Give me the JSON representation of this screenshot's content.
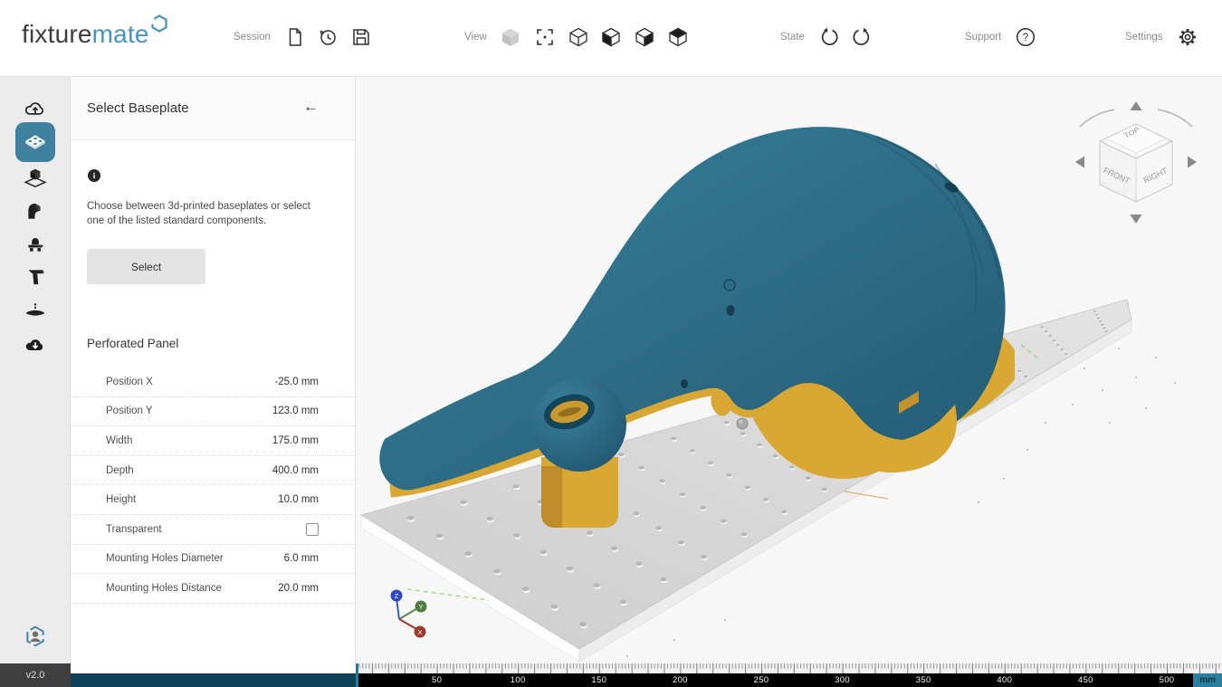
{
  "brand": {
    "name_primary": "fixture",
    "name_secondary": "mate",
    "version": "v2.0"
  },
  "topbar": {
    "session": {
      "label": "Session",
      "icons": [
        "new-file",
        "history",
        "save"
      ]
    },
    "view": {
      "label": "View",
      "icons": [
        "shaded-cube",
        "zoom-fit",
        "cube-wireframe",
        "cube-left-face",
        "cube-right-face",
        "cube-top-face"
      ]
    },
    "state": {
      "label": "State",
      "icons": [
        "undo",
        "redo"
      ]
    },
    "support": {
      "label": "Support",
      "icon": "help-circle"
    },
    "settings": {
      "label": "Settings",
      "icon": "gear"
    }
  },
  "sidebar": {
    "items": [
      {
        "name": "import-part",
        "icon": "cloud-upload-icon",
        "active": false
      },
      {
        "name": "select-baseplate",
        "icon": "baseplate-icon",
        "active": true
      },
      {
        "name": "orient-part",
        "icon": "part-on-plate-icon",
        "active": false
      },
      {
        "name": "fixture-body",
        "icon": "fixture-block-icon",
        "active": false
      },
      {
        "name": "supports",
        "icon": "part-supports-icon",
        "active": false
      },
      {
        "name": "clamps",
        "icon": "clamp-icon",
        "active": false
      },
      {
        "name": "spacers",
        "icon": "disc-icon",
        "active": false
      },
      {
        "name": "export",
        "icon": "cloud-download-icon",
        "active": false
      },
      {
        "name": "account",
        "icon": "user-hexagon-icon",
        "active": false
      }
    ]
  },
  "panel": {
    "title": "Select Baseplate",
    "back_arrow": "←",
    "info_icon": "i",
    "description": "Choose between 3d-printed baseplates or select one of the listed standard components.",
    "select_button": "Select",
    "section_title": "Perforated Panel",
    "properties": [
      {
        "label": "Position X",
        "value": "-25.0 mm"
      },
      {
        "label": "Position Y",
        "value": "123.0 mm"
      },
      {
        "label": "Width",
        "value": "175.0 mm"
      },
      {
        "label": "Depth",
        "value": "400.0 mm"
      },
      {
        "label": "Height",
        "value": "10.0 mm"
      },
      {
        "label": "Transparent",
        "type": "checkbox",
        "checked": false
      },
      {
        "label": "Mounting Holes Diameter",
        "value": "6.0 mm"
      },
      {
        "label": "Mounting Holes Distance",
        "value": "20.0 mm"
      }
    ]
  },
  "viewport": {
    "navcube": {
      "top": "TOP",
      "front": "FRONT",
      "right": "RIGHT"
    },
    "axes": {
      "x": "X",
      "y": "Y",
      "z": "Z"
    },
    "ruler": {
      "unit": "mm",
      "numbers": [
        50,
        100,
        150,
        200,
        250,
        300,
        350,
        400,
        450,
        500
      ]
    }
  },
  "colors": {
    "accent": "#4181a0",
    "part_teal": "#2d6a84",
    "fixture_yellow": "#d9a733",
    "plate_gray": "#d6d6d6",
    "panel_progress_bar": "#0e4256",
    "axis_x": "#9e3a2c",
    "axis_y": "#4f7d3f",
    "axis_z": "#2f4bbf"
  }
}
